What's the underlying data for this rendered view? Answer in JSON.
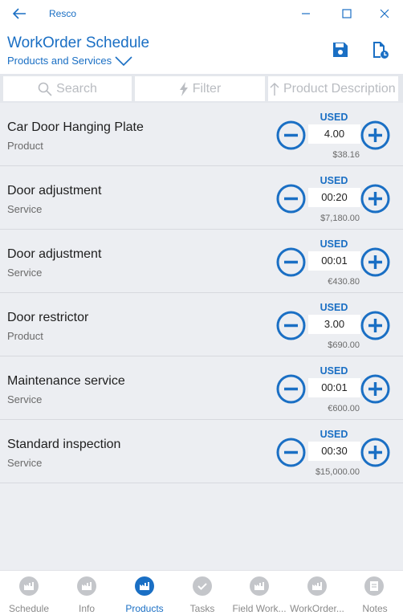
{
  "window": {
    "title": "Resco"
  },
  "header": {
    "title": "WorkOrder Schedule",
    "subtitle": "Products and Services"
  },
  "filterbar": {
    "search_label": "Search",
    "filter_label": "Filter",
    "sort_label": "Product Description"
  },
  "rows": [
    {
      "name": "Car Door Hanging Plate",
      "type": "Product",
      "used_label": "USED",
      "qty": "4.00",
      "price": "$38.16"
    },
    {
      "name": "Door adjustment",
      "type": "Service",
      "used_label": "USED",
      "qty": "00:20",
      "price": "$7,180.00"
    },
    {
      "name": "Door adjustment",
      "type": "Service",
      "used_label": "USED",
      "qty": "00:01",
      "price": "€430.80"
    },
    {
      "name": "Door restrictor",
      "type": "Product",
      "used_label": "USED",
      "qty": "3.00",
      "price": "$690.00"
    },
    {
      "name": "Maintenance service",
      "type": "Service",
      "used_label": "USED",
      "qty": "00:01",
      "price": "€600.00"
    },
    {
      "name": "Standard inspection",
      "type": "Service",
      "used_label": "USED",
      "qty": "00:30",
      "price": "$15,000.00"
    }
  ],
  "tabs": [
    {
      "label": "Schedule",
      "active": false,
      "icon": "factory-icon"
    },
    {
      "label": "Info",
      "active": false,
      "icon": "factory-icon"
    },
    {
      "label": "Products",
      "active": true,
      "icon": "factory-icon"
    },
    {
      "label": "Tasks",
      "active": false,
      "icon": "check-icon"
    },
    {
      "label": "Field Work...",
      "active": false,
      "icon": "factory-icon"
    },
    {
      "label": "WorkOrder...",
      "active": false,
      "icon": "factory-icon"
    },
    {
      "label": "Notes",
      "active": false,
      "icon": "note-icon"
    }
  ],
  "colors": {
    "accent": "#1a6fc4",
    "list_bg": "#eceef2",
    "inactive_icon": "#c4c6ca"
  }
}
